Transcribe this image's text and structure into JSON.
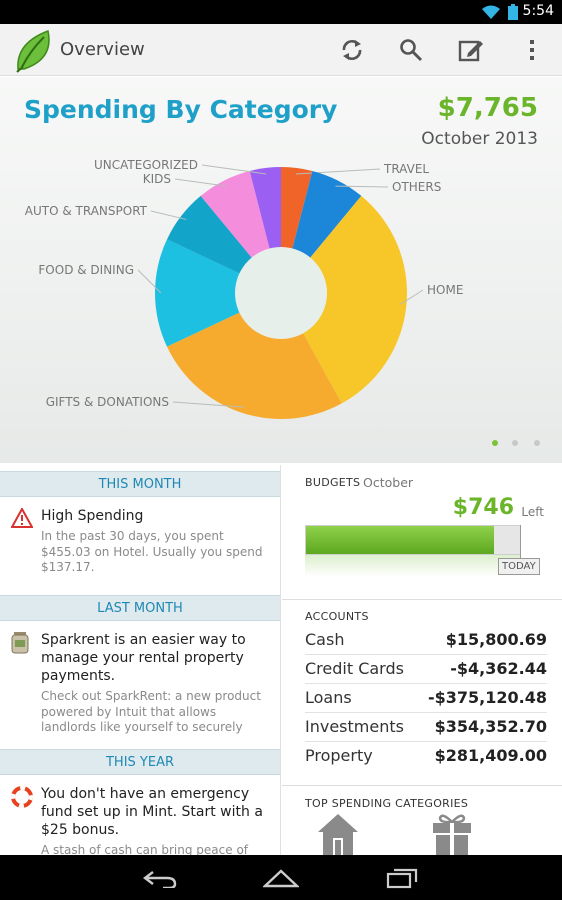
{
  "status_bar": {
    "time": "5:54"
  },
  "action_bar": {
    "title": "Overview"
  },
  "chart_panel": {
    "title": "Spending By Category",
    "total": "$7,765",
    "month": "October 2013",
    "page_count": 3,
    "active_page": 1
  },
  "chart_data": {
    "type": "pie",
    "title": "Spending By Category",
    "donut": true,
    "slices": [
      {
        "label": "TRAVEL",
        "value": 4,
        "color": "#f0642a"
      },
      {
        "label": "OTHERS",
        "value": 7,
        "color": "#1c86d8"
      },
      {
        "label": "HOME",
        "value": 31,
        "color": "#f7c629"
      },
      {
        "label": "GIFTS & DONATIONS",
        "value": 26,
        "color": "#f7ab2e"
      },
      {
        "label": "FOOD & DINING",
        "value": 14,
        "color": "#1dc0e0"
      },
      {
        "label": "AUTO & TRANSPORT",
        "value": 7,
        "color": "#12a5c9"
      },
      {
        "label": "KIDS",
        "value": 7,
        "color": "#f48ddc"
      },
      {
        "label": "UNCATEGORIZED",
        "value": 4,
        "color": "#9b5ff2"
      }
    ]
  },
  "left": {
    "sections": [
      {
        "header": "THIS MONTH",
        "alert_title": "High Spending",
        "alert_body": "In the past 30 days, you spent $455.03 on Hotel.  Usually you spend $137.17.",
        "icon": "warning-icon"
      },
      {
        "header": "LAST MONTH",
        "alert_title": "Sparkrent is an easier way to manage your rental property payments.",
        "alert_body": "Check out SparkRent: a new product powered by Intuit that allows landlords like yourself to securely",
        "icon": "money-jar-icon"
      },
      {
        "header": "THIS YEAR",
        "alert_title": "You don't have an emergency fund set up in Mint. Start with a $25 bonus.",
        "alert_body": "A stash of cash can bring peace of",
        "icon": "lifebuoy-icon"
      }
    ]
  },
  "right": {
    "budgets_label": "BUDGETS",
    "budgets_month": "October",
    "budget_amount": "$746",
    "budget_left": "Left",
    "budget_progress": 0.88,
    "today_label": "TODAY",
    "accounts_label": "ACCOUNTS",
    "accounts": [
      {
        "name": "Cash",
        "value": "$15,800.69"
      },
      {
        "name": "Credit Cards",
        "value": "-$4,362.44"
      },
      {
        "name": "Loans",
        "value": "-$375,120.48"
      },
      {
        "name": "Investments",
        "value": "$354,352.70"
      },
      {
        "name": "Property",
        "value": "$281,409.00"
      }
    ],
    "top_spending_label": "TOP SPENDING CATEGORIES",
    "top_spending_icons": [
      "home-icon",
      "gift-icon"
    ]
  },
  "colors": {
    "accent_blue": "#1fa0c9",
    "accent_green": "#6ab52a",
    "section_head_bg": "#dfeaee"
  }
}
